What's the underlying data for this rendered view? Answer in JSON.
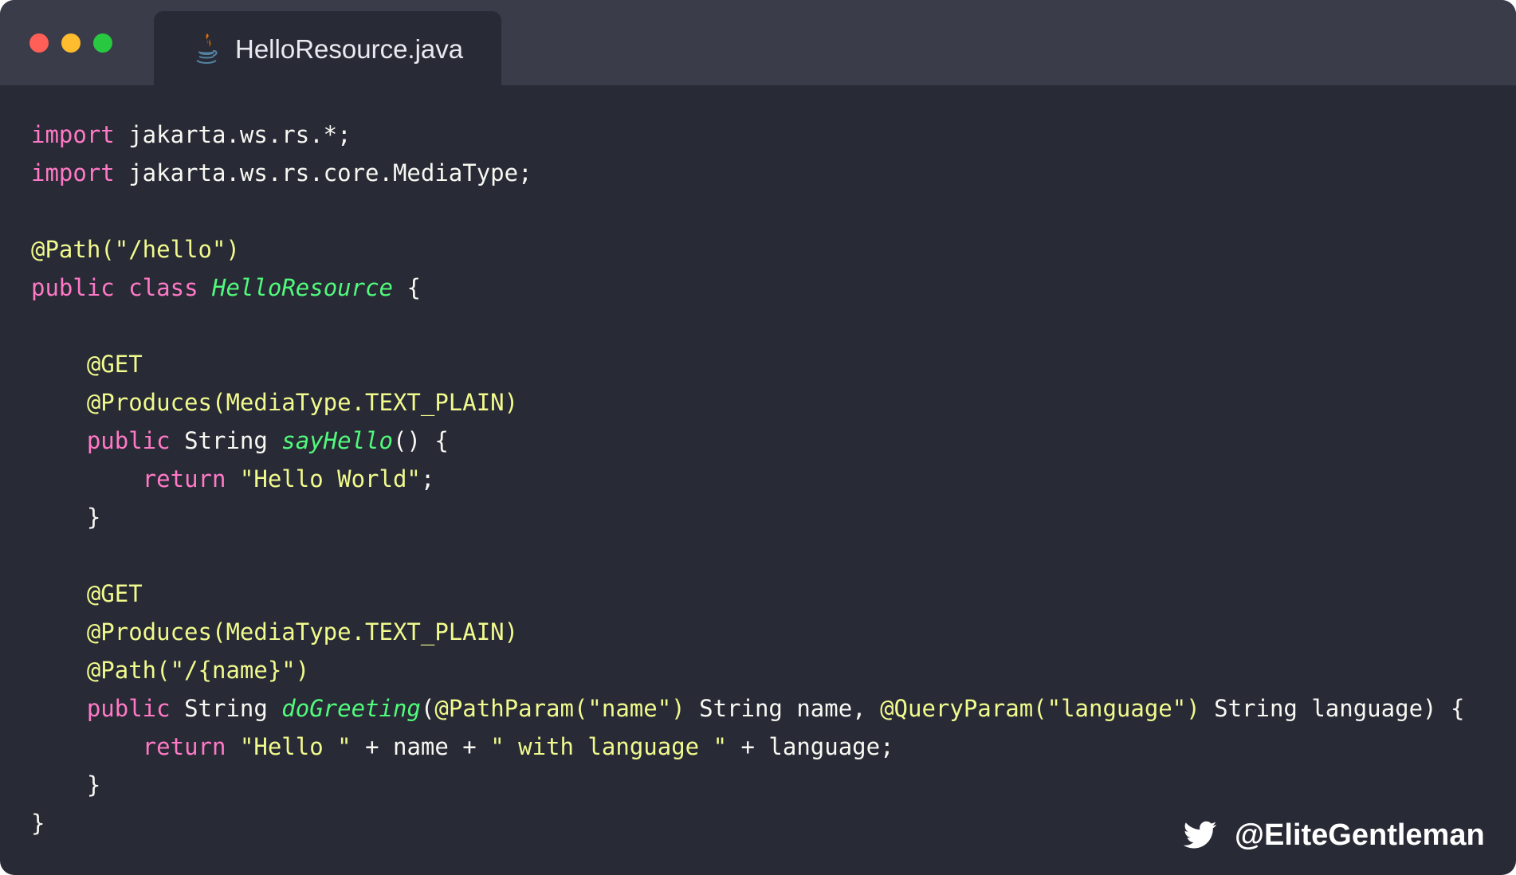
{
  "window": {
    "traffic_lights": [
      "close",
      "minimize",
      "maximize"
    ],
    "colors": {
      "close": "#ff5f57",
      "minimize": "#febc2e",
      "maximize": "#28c840",
      "background": "#282a36",
      "titlebar": "#3a3c4a"
    }
  },
  "tab": {
    "icon": "java-icon",
    "title": "HelloResource.java"
  },
  "code": {
    "language": "java",
    "lines": [
      [
        [
          "import",
          "kw"
        ],
        [
          " jakarta.ws.rs.*;",
          "plain"
        ]
      ],
      [
        [
          "import",
          "kw"
        ],
        [
          " jakarta.ws.rs.core.MediaType;",
          "plain"
        ]
      ],
      [],
      [
        [
          "@Path(\"/hello\")",
          "ann"
        ]
      ],
      [
        [
          "public",
          "kw"
        ],
        [
          " ",
          "plain"
        ],
        [
          "class",
          "kw"
        ],
        [
          " ",
          "plain"
        ],
        [
          "HelloResource",
          "fn"
        ],
        [
          " {",
          "plain"
        ]
      ],
      [],
      [
        [
          "    ",
          "plain"
        ],
        [
          "@GET",
          "ann"
        ]
      ],
      [
        [
          "    ",
          "plain"
        ],
        [
          "@Produces(MediaType.TEXT_PLAIN)",
          "ann"
        ]
      ],
      [
        [
          "    ",
          "plain"
        ],
        [
          "public",
          "kw"
        ],
        [
          " String ",
          "plain"
        ],
        [
          "sayHello",
          "fn"
        ],
        [
          "() {",
          "plain"
        ]
      ],
      [
        [
          "        ",
          "plain"
        ],
        [
          "return",
          "kw"
        ],
        [
          " ",
          "plain"
        ],
        [
          "\"Hello World\"",
          "str"
        ],
        [
          ";",
          "plain"
        ]
      ],
      [
        [
          "    }",
          "plain"
        ]
      ],
      [],
      [
        [
          "    ",
          "plain"
        ],
        [
          "@GET",
          "ann"
        ]
      ],
      [
        [
          "    ",
          "plain"
        ],
        [
          "@Produces(MediaType.TEXT_PLAIN)",
          "ann"
        ]
      ],
      [
        [
          "    ",
          "plain"
        ],
        [
          "@Path(\"/{name}\")",
          "ann"
        ]
      ],
      [
        [
          "    ",
          "plain"
        ],
        [
          "public",
          "kw"
        ],
        [
          " String ",
          "plain"
        ],
        [
          "doGreeting",
          "fn"
        ],
        [
          "(",
          "plain"
        ],
        [
          "@PathParam(\"name\")",
          "ann"
        ],
        [
          " String name, ",
          "plain"
        ],
        [
          "@QueryParam(\"language\")",
          "ann"
        ],
        [
          " String language) {",
          "plain"
        ]
      ],
      [
        [
          "        ",
          "plain"
        ],
        [
          "return",
          "kw"
        ],
        [
          " ",
          "plain"
        ],
        [
          "\"Hello \"",
          "str"
        ],
        [
          " + name + ",
          "plain"
        ],
        [
          "\" with language \"",
          "str"
        ],
        [
          " + language;",
          "plain"
        ]
      ],
      [
        [
          "    }",
          "plain"
        ]
      ],
      [
        [
          "}",
          "plain"
        ]
      ]
    ],
    "token_colors": {
      "kw": "#ff79c6",
      "ann": "#f1fa8c",
      "str": "#f1fa8c",
      "fn": "#50fa7b",
      "plain": "#f8f8f2"
    }
  },
  "footer": {
    "icon": "twitter-bird-icon",
    "handle": "@EliteGentleman"
  }
}
